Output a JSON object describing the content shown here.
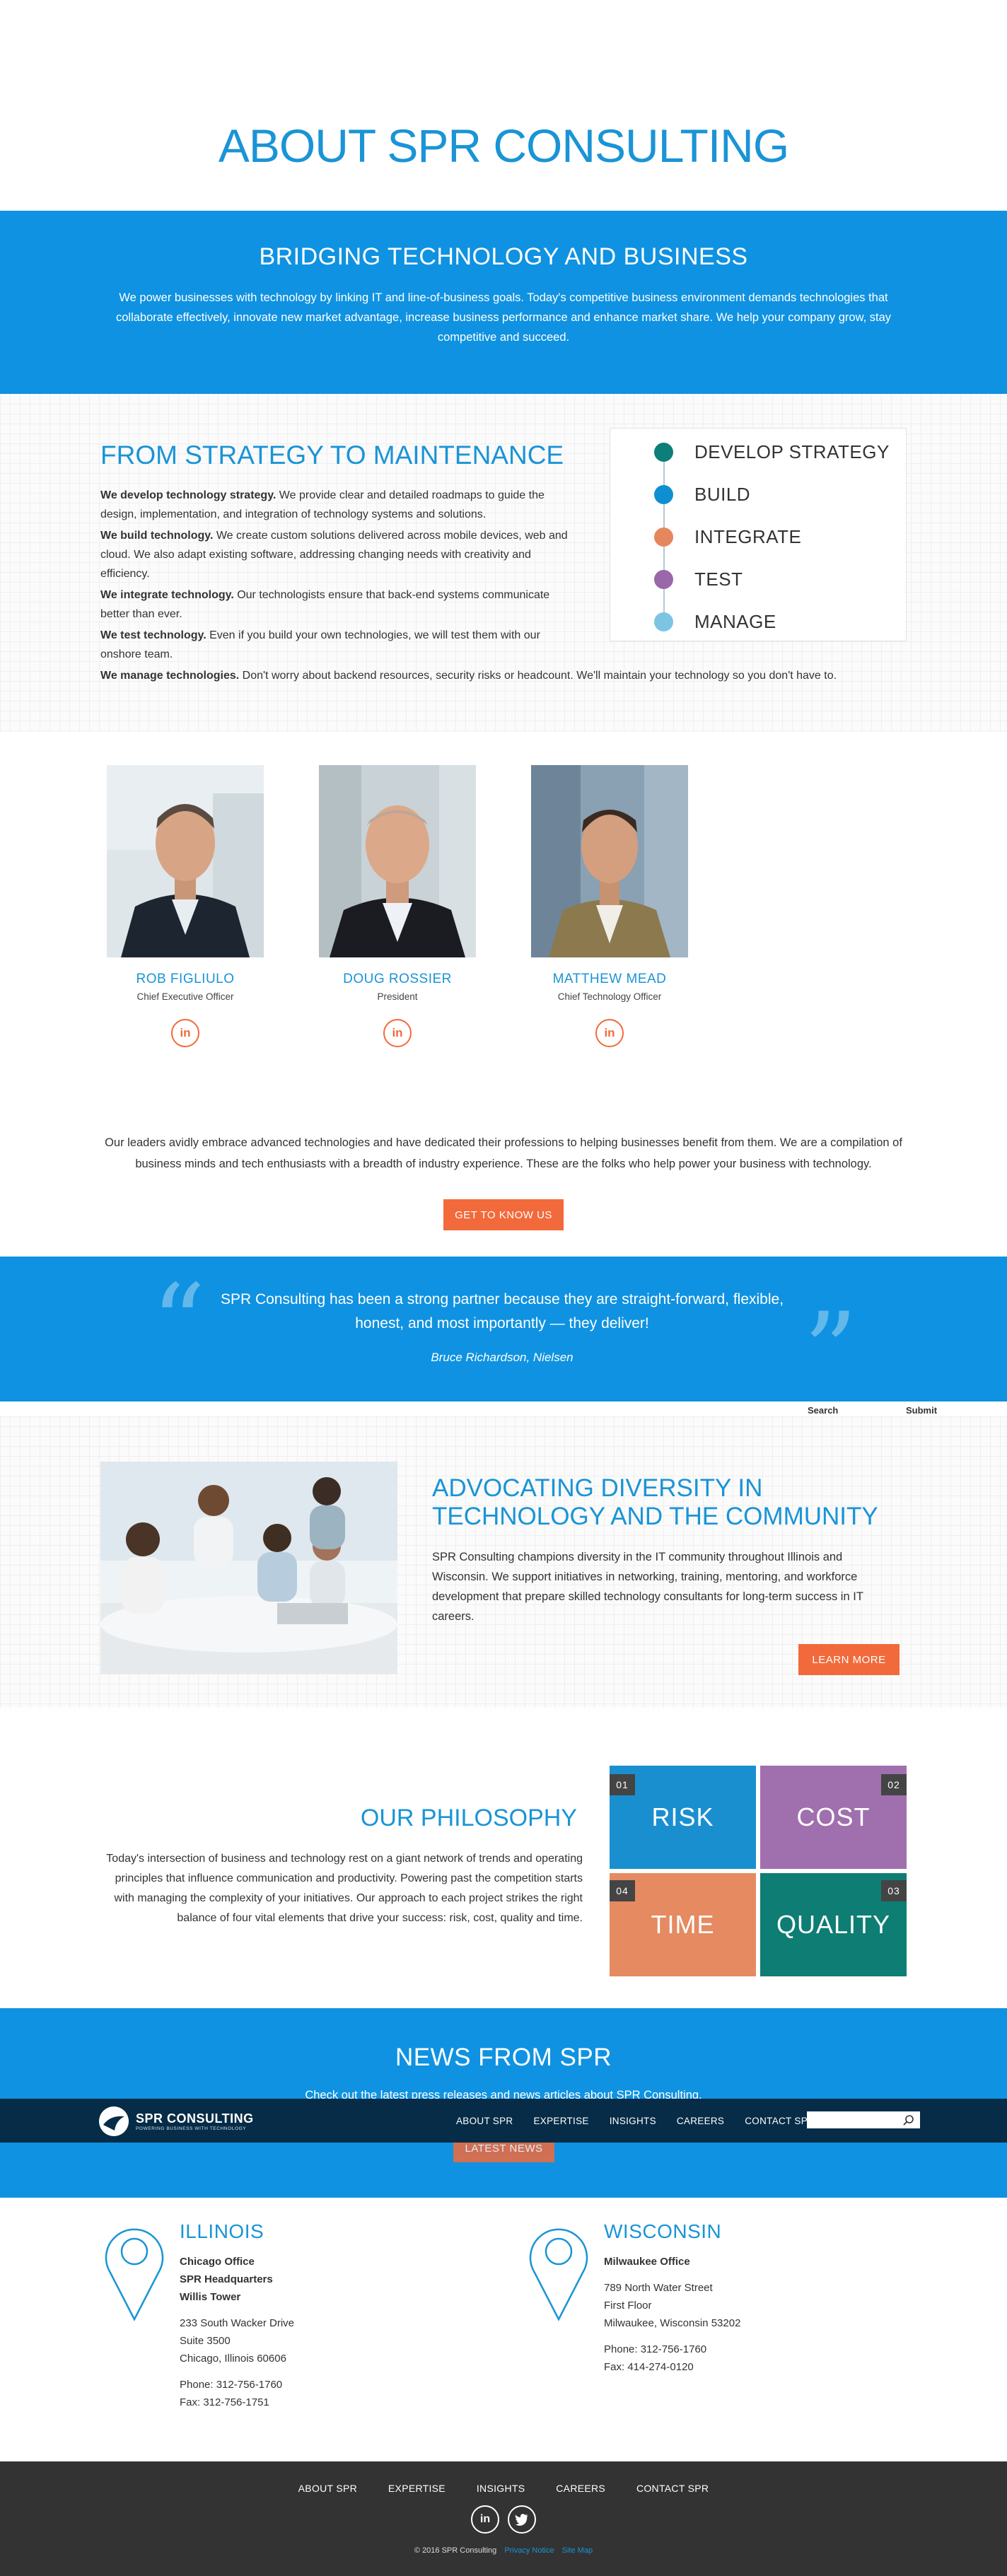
{
  "page": {
    "title": "ABOUT SPR CONSULTING"
  },
  "band1": {
    "heading": "BRIDGING TECHNOLOGY AND BUSINESS",
    "text": "We power businesses with technology by linking IT and line-of-business goals. Today's competitive business environment demands technologies that collaborate effectively, innovate new market advantage, increase business performance and enhance market share. We help your company grow, stay competitive and succeed."
  },
  "strategy": {
    "heading": "FROM STRATEGY TO MAINTENANCE",
    "items": [
      {
        "lead": "We develop technology strategy.",
        "text": " We provide clear and detailed roadmaps to guide the design, implementation, and integration of technology systems and solutions."
      },
      {
        "lead": "We build technology.",
        "text": " We create custom solutions delivered across mobile devices, web and cloud. We also adapt existing software, addressing changing needs with creativity and efficiency."
      },
      {
        "lead": "We integrate technology.",
        "text": " Our technologists ensure that back-end systems communicate better than ever."
      },
      {
        "lead": "We test technology.",
        "text": " Even if you build your own technologies, we will test them with our onshore team."
      },
      {
        "lead": "We manage technologies.",
        "text": " Don't worry about backend resources, security risks or headcount. We'll maintain your technology so you don't have to."
      }
    ],
    "steps": [
      {
        "label": "DEVELOP STRATEGY",
        "color": "#0d7e78"
      },
      {
        "label": "BUILD",
        "color": "#0f8fd0"
      },
      {
        "label": "INTEGRATE",
        "color": "#e5875e"
      },
      {
        "label": "TEST",
        "color": "#9a67a8"
      },
      {
        "label": "MANAGE",
        "color": "#7dc4e4"
      }
    ]
  },
  "team": {
    "members": [
      {
        "name": "ROB FIGLIULO",
        "role": "Chief Executive Officer",
        "linkedin": "in"
      },
      {
        "name": "DOUG ROSSIER",
        "role": "President",
        "linkedin": "in"
      },
      {
        "name": "MATTHEW MEAD",
        "role": "Chief Technology Officer",
        "linkedin": "in"
      }
    ],
    "intro": "Our leaders avidly embrace advanced technologies and have dedicated their professions to helping businesses benefit from them. We are a compilation of business minds and tech enthusiasts with a breadth of industry experience. These are the folks who help power your business with technology.",
    "button": "GET TO KNOW US"
  },
  "quote": {
    "text": "SPR Consulting has been a strong partner because they are straight-forward, flexible, honest, and most importantly — they deliver!",
    "author": "Bruce Richardson, Nielsen",
    "open_mark": "“",
    "close_mark": "”"
  },
  "search": {
    "label": "Search",
    "submit": "Submit"
  },
  "diversity": {
    "heading": "ADVOCATING DIVERSITY IN TECHNOLOGY AND THE COMMUNITY",
    "text": "SPR Consulting champions diversity in the IT community throughout Illinois and Wisconsin. We support initiatives in networking, training, mentoring, and workforce development that prepare skilled technology consultants for long-term success in IT careers.",
    "button": "LEARN MORE"
  },
  "philosophy": {
    "heading": "OUR PHILOSOPHY",
    "text": "Today's intersection of business and technology rest on a giant network of trends and operating principles that influence communication and productivity. Powering past the competition starts with managing the complexity of your initiatives. Our approach to each project strikes the right balance of four vital elements that drive your success: risk, cost, quality and time.",
    "pieces": [
      {
        "num": "01",
        "label": "RISK",
        "color": "#1a8fd0"
      },
      {
        "num": "02",
        "label": "COST",
        "color": "#a06fae"
      },
      {
        "num": "04",
        "label": "TIME",
        "color": "#e58a61"
      },
      {
        "num": "03",
        "label": "QUALITY",
        "color": "#0e7d73"
      }
    ]
  },
  "news": {
    "heading": "NEWS FROM SPR",
    "sub": "Check out the latest press releases and news articles about SPR Consulting.",
    "button": "LATEST NEWS"
  },
  "nav": {
    "logo_word": "SPR CONSULTING",
    "logo_tag": "POWERING BUSINESS WITH TECHNOLOGY",
    "links": [
      "ABOUT SPR",
      "EXPERTISE",
      "INSIGHTS",
      "CAREERS",
      "CONTACT SPR"
    ],
    "search_placeholder": ""
  },
  "offices": {
    "illinois": {
      "state": "ILLINOIS",
      "bold": [
        "Chicago Office",
        "SPR Headquarters",
        "Willis Tower"
      ],
      "address": [
        "233 South Wacker Drive",
        "Suite 3500",
        "Chicago, Illinois  60606"
      ],
      "phone": "Phone: 312-756-1760",
      "fax": "Fax: 312-756-1751"
    },
    "wisconsin": {
      "state": "WISCONSIN",
      "bold": [
        "Milwaukee Office"
      ],
      "address": [
        "789 North Water Street",
        "First Floor",
        "Milwaukee, Wisconsin  53202"
      ],
      "phone": "Phone: 312-756-1760",
      "fax": "Fax: 414-274-0120"
    }
  },
  "footer": {
    "links": [
      "ABOUT SPR",
      "EXPERTISE",
      "INSIGHTS",
      "CAREERS",
      "CONTACT SPR"
    ],
    "copyright": "© 2016 SPR Consulting",
    "privacy": "Privacy Notice",
    "sitemap": "Site Map"
  },
  "colors": {
    "brand_blue": "#0f92e1",
    "accent_orange": "#f26a3b",
    "nav_navy": "#062c47",
    "footer_gray": "#333333"
  }
}
